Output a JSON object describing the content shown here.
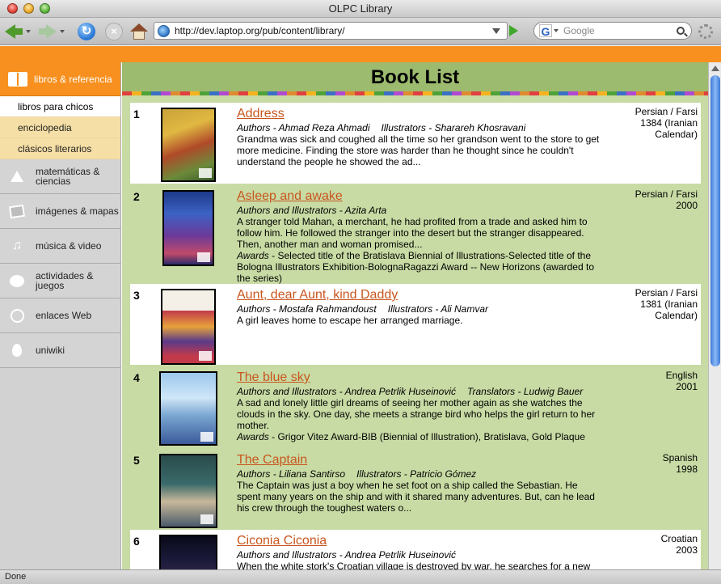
{
  "window": {
    "title": "OLPC Library"
  },
  "toolbar": {
    "url": "http://dev.laptop.org/pub/content/library/",
    "search_placeholder": "Google",
    "search_engine_letter": "G"
  },
  "sidebar": {
    "active": {
      "label": "libros & referencia"
    },
    "subitems": [
      {
        "label": "libros para chicos"
      },
      {
        "label": "enciclopedia"
      },
      {
        "label": "clásicos literarios"
      }
    ],
    "items": [
      {
        "label": "matemáticas &\nciencias"
      },
      {
        "label": "imágenes & mapas"
      },
      {
        "label": "música & video"
      },
      {
        "label": "actividades &\njuegos"
      },
      {
        "label": "enlaces Web"
      },
      {
        "label": "uniwiki"
      }
    ]
  },
  "page": {
    "heading": "Book List"
  },
  "books": [
    {
      "num": "1",
      "title": "Address",
      "credit1_role": "Authors",
      "credit1_name": "Ahmad Reza Ahmadi",
      "credit2_role": "Illustrators",
      "credit2_name": "Sharareh Khosravani",
      "desc": "Grandma was sick and coughed all the time so her grandson went to the store to get more medicine. Finding the store was harder than he thought since he couldn't understand the people he showed the ad...",
      "awards": "",
      "lang": "Persian / Farsi",
      "year": "1384 (Iranian\nCalendar)"
    },
    {
      "num": "2",
      "title": "Asleep and awake",
      "credit1_role": "Authors and Illustrators",
      "credit1_name": "Azita Arta",
      "credit2_role": "",
      "credit2_name": "",
      "desc": "A stranger told Mahan, a merchant, he had profited from a trade and asked him to follow him. He followed the stranger into the desert but the stranger disappeared. Then, another man and woman promised...",
      "awards_label": "Awards",
      "awards": "Selected title of the Bratislava Biennial of Illustrations-Selected title of the Bologna Illustrators Exhibition-BolognaRagazzi Award -- New Horizons (awarded to the series)",
      "lang": "Persian / Farsi",
      "year": "2000"
    },
    {
      "num": "3",
      "title": "Aunt, dear Aunt, kind Daddy",
      "credit1_role": "Authors",
      "credit1_name": "Mostafa Rahmandoust",
      "credit2_role": "Illustrators",
      "credit2_name": "Ali Namvar",
      "desc": "A girl leaves home to escape her arranged marriage.",
      "awards": "",
      "lang": "Persian / Farsi",
      "year": "1381 (Iranian\nCalendar)"
    },
    {
      "num": "4",
      "title": "The blue sky",
      "credit1_role": "Authors and Illustrators",
      "credit1_name": "Andrea Petrlik Huseinović",
      "credit2_role": "Translators",
      "credit2_name": "Ludwig Bauer",
      "desc": "A sad and lonely little girl dreams of seeing her mother again as she watches the clouds in the sky. One day, she meets a strange bird who helps the girl return to her mother.",
      "awards_label": "Awards",
      "awards": "Grigor Vitez Award-BIB (Biennial of Illustration), Bratislava, Gold Plaque",
      "lang": "English",
      "year": "2001"
    },
    {
      "num": "5",
      "title": "The Captain",
      "credit1_role": "Authors",
      "credit1_name": "Liliana Santirso",
      "credit2_role": "Illustrators",
      "credit2_name": "Patricio Gómez",
      "desc": "The Captain was just a boy when he set foot on a ship called the Sebastian. He spent many years on the ship and with it shared many adventures. But, can he lead his crew through the toughest waters o...",
      "awards": "",
      "lang": "Spanish",
      "year": "1998"
    },
    {
      "num": "6",
      "title": "Ciconia Ciconia",
      "credit1_role": "Authors and Illustrators",
      "credit1_name": "Andrea Petrlik Huseinović",
      "credit2_role": "",
      "credit2_name": "",
      "desc": "When the white stork's Croatian village is destroyed by war, he searches for a new",
      "awards": "",
      "lang": "Croatian",
      "year": "2003"
    }
  ],
  "status": {
    "text": "Done"
  },
  "colors": {
    "orange": "#f7901e",
    "green_row": "#c8dba4",
    "header_green": "#9dbb6e",
    "link": "#c8561e"
  }
}
